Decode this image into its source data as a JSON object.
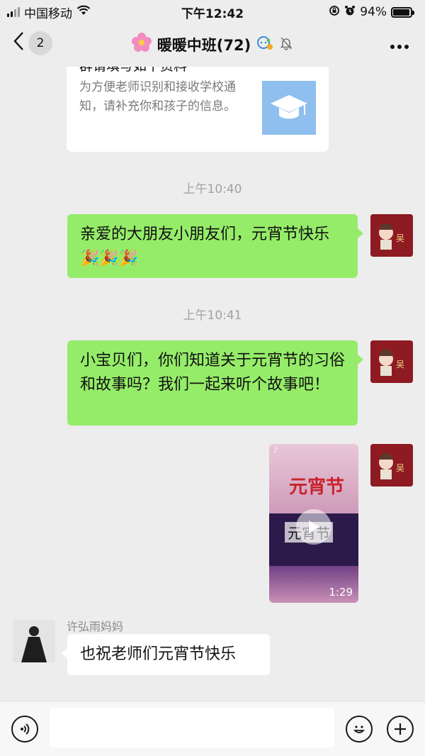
{
  "status_bar": {
    "carrier": "中国移动",
    "time": "下午12:42",
    "battery": "94%",
    "battery_level": 0.94
  },
  "nav": {
    "back_count": "2",
    "title": "暖暖中班(72)"
  },
  "messages": {
    "card": {
      "title": "群请填写如下资料",
      "desc": "为方便老师识别和接收学校通知，请补充你和孩子的信息。"
    },
    "time1": "上午10:40",
    "msg1": "亲爱的大朋友小朋友们，元宵节快乐🎉🎉🎉",
    "time2": "上午10:41",
    "msg2": "小宝贝们，你们知道关于元宵节的习俗和故事吗？我们一起来听个故事吧！",
    "video": {
      "title": "元宵节",
      "overlay_title": "元宵节",
      "duration": "1:29"
    },
    "sender_name": "许弘雨妈妈",
    "msg3": "也祝老师们元宵节快乐"
  },
  "input": {
    "placeholder": ""
  },
  "colors": {
    "background": "#ededed",
    "outgoing_bubble": "#95ec69",
    "incoming_bubble": "#ffffff"
  }
}
